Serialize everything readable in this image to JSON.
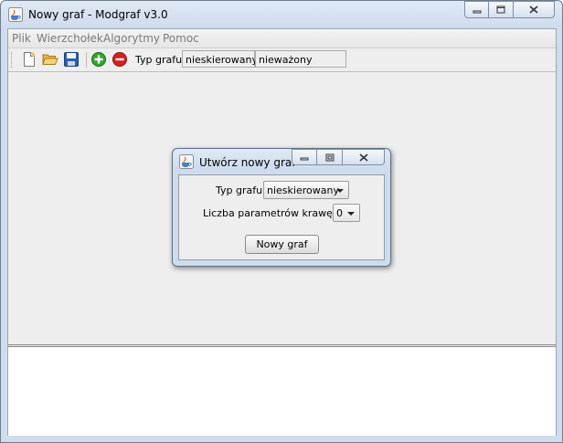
{
  "window": {
    "title": "Nowy graf - Modgraf v3.0",
    "icon": "java-coffee-icon"
  },
  "menubar": {
    "items": [
      "Plik",
      "Wierzchołek",
      "Algorytmy",
      "Pomoc"
    ]
  },
  "toolbar": {
    "icons": [
      "new-file-icon",
      "open-folder-icon",
      "save-disk-icon",
      "add-green-icon",
      "remove-red-icon"
    ],
    "graph_type_label": "Typ grafu:",
    "graph_direction": "nieskierowany",
    "graph_weight": "nieważony"
  },
  "dialog": {
    "title": "Utwórz nowy graf",
    "type_label": "Typ grafu",
    "type_value": "nieskierowany",
    "params_label": "Liczba parametrów krawędzi",
    "params_value": "0",
    "create_button": "Nowy graf"
  },
  "colors": {
    "frame": "#cfdced",
    "panel": "#eeeeee",
    "add": "#2fa52f",
    "remove": "#d61f1f"
  }
}
